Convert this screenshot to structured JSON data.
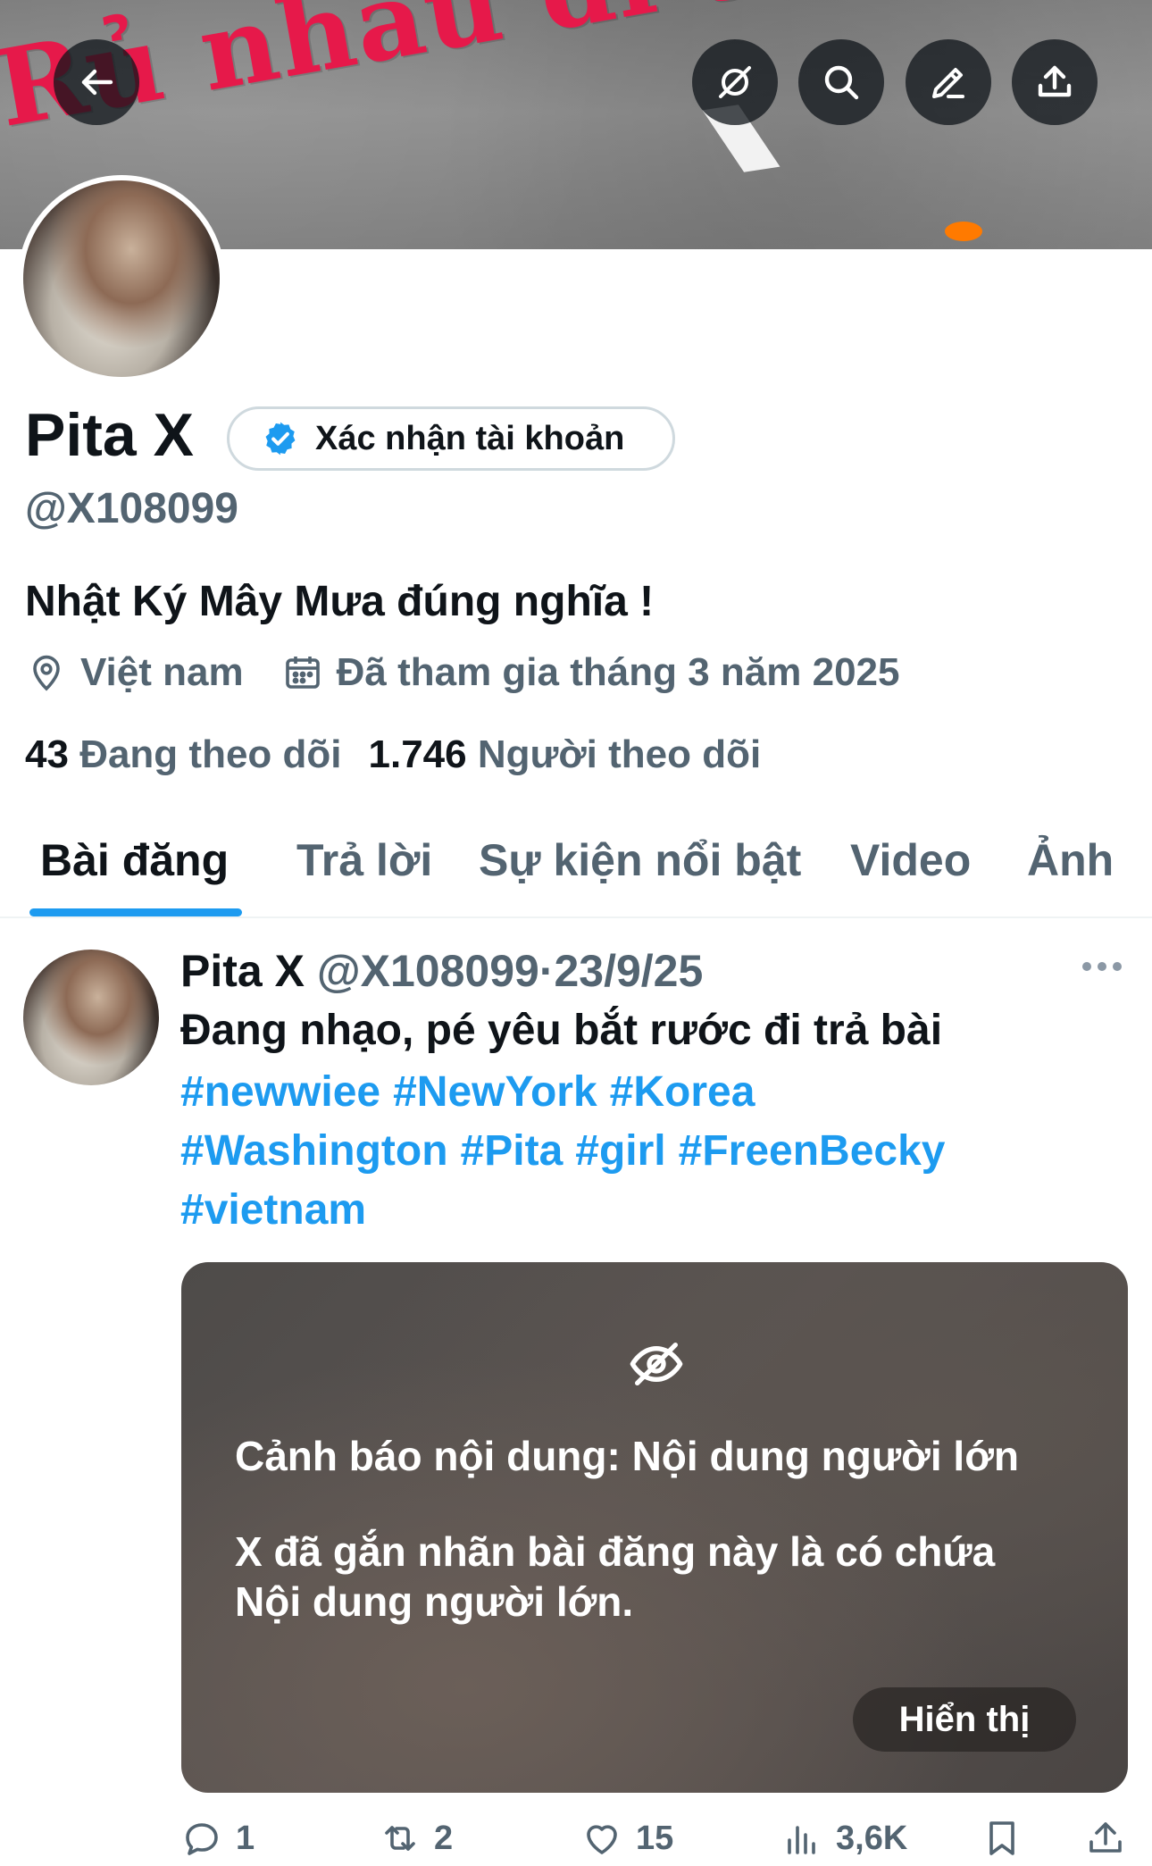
{
  "banner": {
    "text": "Rủ nhau đi tr",
    "buttons": {
      "back": "back-arrow-icon",
      "grok": "grok-icon",
      "search": "search-icon",
      "edit": "edit-icon",
      "share": "share-icon"
    }
  },
  "profile": {
    "name": "Pita X",
    "verify_label": "Xác nhận tài khoản",
    "handle": "@X108099",
    "bio": "Nhật Ký Mây Mưa đúng nghĩa !",
    "location": "Việt nam",
    "joined": "Đã tham gia tháng 3 năm 2025",
    "following_count": "43",
    "following_label": "Đang theo dõi",
    "followers_count": "1.746",
    "followers_label": "Người theo dõi"
  },
  "tabs": [
    {
      "label": "Bài đăng",
      "active": true
    },
    {
      "label": "Trả lời",
      "active": false
    },
    {
      "label": "Sự kiện nổi bật",
      "active": false
    },
    {
      "label": "Video",
      "active": false
    },
    {
      "label": "Ảnh",
      "active": false
    }
  ],
  "post": {
    "author_name": "Pita X",
    "author_handle": "@X108099",
    "separator": "·",
    "date": "23/9/25",
    "text": "Đang nhạo, pé yêu bắt rước đi trả bài",
    "hashtags": [
      "#newwiee",
      "#NewYork",
      "#Korea",
      "#Washington",
      "#Pita",
      "#girl",
      "#FreenBecky",
      "#vietnam"
    ],
    "warning_title": "Cảnh báo nội dung: Nội dung người lớn",
    "warning_body": "X đã gắn nhãn bài đăng này là có chứa Nội dung người lớn.",
    "show_label": "Hiển thị",
    "replies": "1",
    "reposts": "2",
    "likes": "15",
    "views": "3,6K"
  },
  "colors": {
    "accent": "#1d9bf0",
    "text": "#0f1419",
    "muted": "#536471",
    "banner_text": "#e6194a"
  }
}
